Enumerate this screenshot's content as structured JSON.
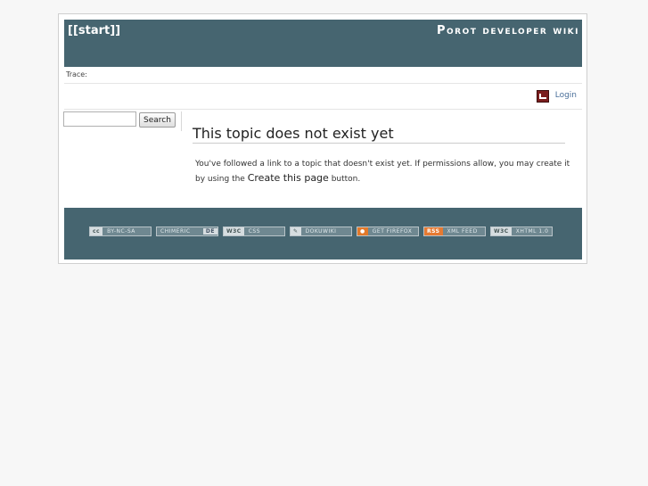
{
  "header": {
    "page_title": "[[start]]",
    "wiki_name": "Porot developer wiki"
  },
  "breadcrumb": {
    "trace_label": "Trace:"
  },
  "user": {
    "login_label": "Login"
  },
  "search": {
    "placeholder": "",
    "value": "",
    "button_label": "Search"
  },
  "content": {
    "heading": "This topic does not exist yet",
    "text_before": "You've followed a link to a topic that doesn't exist yet. If permissions allow, you may create it by using the",
    "create_label": "Create this page",
    "text_after": "button."
  },
  "footer": {
    "badges": [
      {
        "left": "cc",
        "right": "BY-NC-SA"
      },
      {
        "left": "CHIMERIC",
        "right": "DE"
      },
      {
        "left": "W3C",
        "right": "CSS"
      },
      {
        "left": "",
        "right": "DOKUWIKI"
      },
      {
        "left": "",
        "right": "GET FIREFOX"
      },
      {
        "left": "RSS",
        "right": "XML FEED"
      },
      {
        "left": "W3C",
        "right": "XHTML 1.0"
      }
    ]
  },
  "colors": {
    "header_bg": "#466570",
    "page_bg": "#f7f7f7",
    "link": "#4a6f9a"
  }
}
